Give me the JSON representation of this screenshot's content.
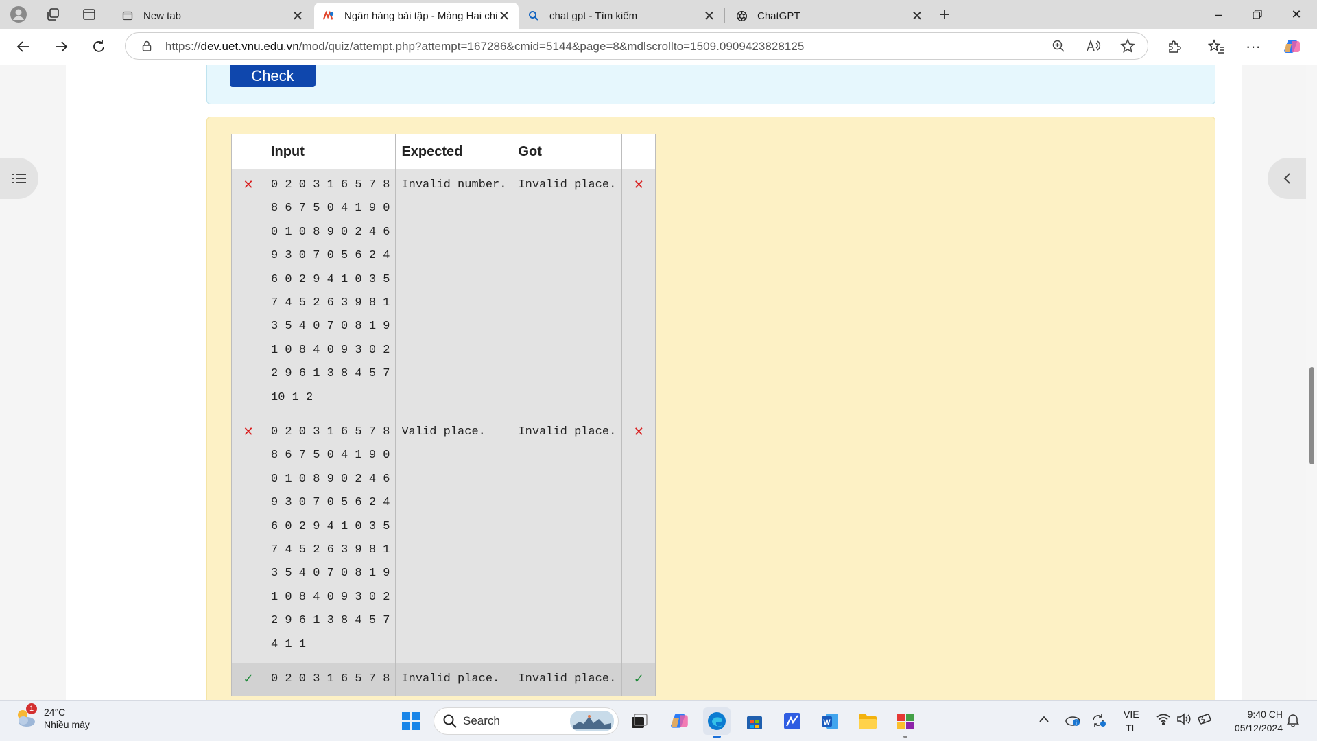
{
  "browser": {
    "tabs": [
      {
        "title": "New tab",
        "icon": "new-tab-page-icon"
      },
      {
        "title": "Ngân hàng bài tập - Mảng Hai chiều",
        "icon": "moodle-logo-icon"
      },
      {
        "title": "chat gpt - Tìm kiếm",
        "icon": "bing-search-icon"
      },
      {
        "title": "ChatGPT",
        "icon": "openai-icon"
      }
    ],
    "url": {
      "prefix": "https://",
      "host": "dev.uet.vnu.edu.vn",
      "path": "/mod/quiz/attempt.php?attempt=167286&cmid=5144&page=8&mdlscrollto=1509.0909423828125"
    }
  },
  "page": {
    "check_label": "Check",
    "table": {
      "headers": [
        "",
        "Input",
        "Expected",
        "Got",
        ""
      ],
      "rows": [
        {
          "status": "fail",
          "input": [
            "0 2 0 3 1 6 5 7 8",
            "8 6 7 5 0 4 1 9 0",
            "0 1 0 8 9 0 2 4 6",
            "9 3 0 7 0 5 6 2 4",
            "6 0 2 9 4 1 0 3 5",
            "7 4 5 2 6 3 9 8 1",
            "3 5 4 0 7 0 8 1 9",
            "1 0 8 4 0 9 3 0 2",
            "2 9 6 1 3 8 4 5 7",
            "10 1 2"
          ],
          "expected": "Invalid number.",
          "got": "Invalid place."
        },
        {
          "status": "fail",
          "input": [
            "0 2 0 3 1 6 5 7 8",
            "8 6 7 5 0 4 1 9 0",
            "0 1 0 8 9 0 2 4 6",
            "9 3 0 7 0 5 6 2 4",
            "6 0 2 9 4 1 0 3 5",
            "7 4 5 2 6 3 9 8 1",
            "3 5 4 0 7 0 8 1 9",
            "1 0 8 4 0 9 3 0 2",
            "2 9 6 1 3 8 4 5 7",
            "4 1 1"
          ],
          "expected": "Valid place.",
          "got": "Invalid place."
        },
        {
          "status": "pass",
          "input": [
            "0 2 0 3 1 6 5 7 8"
          ],
          "expected": "Invalid place.",
          "got": "Invalid place."
        }
      ]
    }
  },
  "taskbar": {
    "weather": {
      "temp": "24°C",
      "desc": "Nhiều mây",
      "badge": "1"
    },
    "search_label": "Search",
    "lang": {
      "line1": "VIE",
      "line2": "TL"
    },
    "clock": {
      "time": "9:40 CH",
      "date": "05/12/2024"
    }
  }
}
